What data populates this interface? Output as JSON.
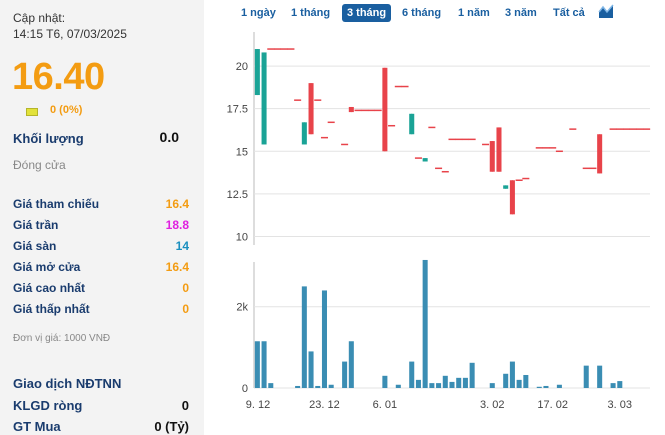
{
  "header": {
    "update_label": "Cập nhật:",
    "update_time": "14:15 T6, 07/03/2025",
    "price": "16.40",
    "change": "0 (0%)",
    "volume_label": "Khối lượng",
    "volume_value": "0.0",
    "close_label": "Đóng cửa"
  },
  "stats": [
    {
      "label": "Giá tham chiếu",
      "value": "16.4",
      "color": "#f39c12"
    },
    {
      "label": "Giá trần",
      "value": "18.8",
      "color": "#e020e0"
    },
    {
      "label": "Giá sàn",
      "value": "14",
      "color": "#1a8fbf"
    },
    {
      "label": "Giá mở cửa",
      "value": "16.4",
      "color": "#f39c12"
    },
    {
      "label": "Giá cao nhất",
      "value": "0",
      "color": "#f39c12"
    },
    {
      "label": "Giá thấp nhất",
      "value": "0",
      "color": "#f39c12"
    }
  ],
  "unit_note": "Đơn vị giá: 1000 VNĐ",
  "foreign": {
    "title": "Giao dịch NĐTNN",
    "net_label": "KLGD ròng",
    "net_value": "0",
    "buy_label": "GT Mua",
    "buy_value": "0 (Tỷ)"
  },
  "tabs": [
    {
      "label": "1 ngày",
      "active": false
    },
    {
      "label": "1 tháng",
      "active": false
    },
    {
      "label": "3 tháng",
      "active": true
    },
    {
      "label": "6 tháng",
      "active": false
    },
    {
      "label": "1 năm",
      "active": false
    },
    {
      "label": "3 năm",
      "active": false
    },
    {
      "label": "Tất cả",
      "active": false
    }
  ],
  "chart_icon": "area-chart-icon",
  "colors": {
    "up": "#1aa396",
    "down": "#e8434a",
    "volume": "#3a8db3",
    "accent": "#1a5fa0"
  },
  "chart_data": {
    "type": "candlestick",
    "price_ticks": [
      "20",
      "17.5",
      "15",
      "12.5",
      "10"
    ],
    "price_tick_values": [
      20,
      17.5,
      15,
      12.5,
      10
    ],
    "price_range": [
      9.5,
      22
    ],
    "volume_ticks": [
      "2k",
      "0"
    ],
    "volume_tick_values": [
      2000,
      0
    ],
    "volume_range": [
      0,
      3100
    ],
    "x_labels": [
      "9. 12",
      "23. 12",
      "6. 01",
      "3. 02",
      "17. 02",
      "3. 03"
    ],
    "x_label_index": [
      0,
      10,
      19,
      35,
      44,
      54
    ],
    "candles": [
      {
        "o": 18.3,
        "h": 21.0,
        "l": 18.3,
        "c": 21.0,
        "v": 1150
      },
      {
        "o": 15.4,
        "h": 20.8,
        "l": 15.4,
        "c": 20.8,
        "v": 1150
      },
      {
        "o": 21.0,
        "h": 21.0,
        "l": 21.0,
        "c": 21.0,
        "v": 120
      },
      {
        "o": 21.0,
        "h": 21.0,
        "l": 21.0,
        "c": 21.0,
        "v": 0
      },
      {
        "o": 21.0,
        "h": 21.0,
        "l": 21.0,
        "c": 21.0,
        "v": 0
      },
      {
        "o": 21.0,
        "h": 21.0,
        "l": 21.0,
        "c": 21.0,
        "v": 0
      },
      {
        "o": 18.0,
        "h": 18.0,
        "l": 18.0,
        "c": 18.0,
        "v": 50
      },
      {
        "o": 15.4,
        "h": 16.7,
        "l": 15.4,
        "c": 16.7,
        "v": 2500
      },
      {
        "o": 19.0,
        "h": 19.0,
        "l": 16.0,
        "c": 16.0,
        "v": 900
      },
      {
        "o": 18.0,
        "h": 18.0,
        "l": 18.0,
        "c": 18.0,
        "v": 50
      },
      {
        "o": 15.8,
        "h": 15.8,
        "l": 15.8,
        "c": 15.8,
        "v": 2400
      },
      {
        "o": 16.7,
        "h": 16.7,
        "l": 16.7,
        "c": 16.7,
        "v": 80
      },
      {
        "o": 0,
        "h": 0,
        "l": 0,
        "c": 0,
        "v": 0
      },
      {
        "o": 15.4,
        "h": 15.4,
        "l": 15.4,
        "c": 15.4,
        "v": 650
      },
      {
        "o": 17.6,
        "h": 17.6,
        "l": 17.3,
        "c": 17.3,
        "v": 1150
      },
      {
        "o": 17.4,
        "h": 17.4,
        "l": 17.4,
        "c": 17.4,
        "v": 0
      },
      {
        "o": 17.4,
        "h": 17.4,
        "l": 17.4,
        "c": 17.4,
        "v": 0
      },
      {
        "o": 17.4,
        "h": 17.4,
        "l": 17.4,
        "c": 17.4,
        "v": 0
      },
      {
        "o": 17.4,
        "h": 17.4,
        "l": 17.4,
        "c": 17.4,
        "v": 0
      },
      {
        "o": 19.9,
        "h": 19.9,
        "l": 15.0,
        "c": 15.0,
        "v": 300
      },
      {
        "o": 16.5,
        "h": 16.5,
        "l": 16.5,
        "c": 16.5,
        "v": 0
      },
      {
        "o": 18.8,
        "h": 18.8,
        "l": 18.8,
        "c": 18.8,
        "v": 80
      },
      {
        "o": 18.8,
        "h": 18.8,
        "l": 18.8,
        "c": 18.8,
        "v": 0
      },
      {
        "o": 16.0,
        "h": 17.2,
        "l": 16.0,
        "c": 17.2,
        "v": 650
      },
      {
        "o": 14.6,
        "h": 14.6,
        "l": 14.6,
        "c": 14.6,
        "v": 200
      },
      {
        "o": 14.4,
        "h": 14.6,
        "l": 14.4,
        "c": 14.6,
        "v": 3150
      },
      {
        "o": 16.4,
        "h": 16.4,
        "l": 16.4,
        "c": 16.4,
        "v": 120
      },
      {
        "o": 14.0,
        "h": 14.0,
        "l": 14.0,
        "c": 14.0,
        "v": 120
      },
      {
        "o": 13.8,
        "h": 13.8,
        "l": 13.8,
        "c": 13.8,
        "v": 300
      },
      {
        "o": 15.7,
        "h": 15.7,
        "l": 15.7,
        "c": 15.7,
        "v": 150
      },
      {
        "o": 15.7,
        "h": 15.7,
        "l": 15.7,
        "c": 15.7,
        "v": 250
      },
      {
        "o": 15.7,
        "h": 15.7,
        "l": 15.7,
        "c": 15.7,
        "v": 250
      },
      {
        "o": 15.7,
        "h": 15.7,
        "l": 15.7,
        "c": 15.7,
        "v": 620
      },
      {
        "o": 0,
        "h": 0,
        "l": 0,
        "c": 0,
        "v": 0
      },
      {
        "o": 15.4,
        "h": 15.4,
        "l": 15.4,
        "c": 15.4,
        "v": 0
      },
      {
        "o": 15.6,
        "h": 15.6,
        "l": 13.8,
        "c": 13.8,
        "v": 120
      },
      {
        "o": 16.4,
        "h": 16.4,
        "l": 13.8,
        "c": 13.8,
        "v": 0
      },
      {
        "o": 12.8,
        "h": 13.0,
        "l": 12.8,
        "c": 13.0,
        "v": 350
      },
      {
        "o": 13.3,
        "h": 13.3,
        "l": 11.3,
        "c": 11.3,
        "v": 650
      },
      {
        "o": 13.3,
        "h": 13.3,
        "l": 13.3,
        "c": 13.3,
        "v": 200
      },
      {
        "o": 13.4,
        "h": 13.4,
        "l": 13.4,
        "c": 13.4,
        "v": 320
      },
      {
        "o": 0,
        "h": 0,
        "l": 0,
        "c": 0,
        "v": 0
      },
      {
        "o": 15.2,
        "h": 15.2,
        "l": 15.2,
        "c": 15.2,
        "v": 30
      },
      {
        "o": 15.2,
        "h": 15.2,
        "l": 15.2,
        "c": 15.2,
        "v": 50
      },
      {
        "o": 15.2,
        "h": 15.2,
        "l": 15.2,
        "c": 15.2,
        "v": 0
      },
      {
        "o": 15.0,
        "h": 15.0,
        "l": 15.0,
        "c": 15.0,
        "v": 80
      },
      {
        "o": 0,
        "h": 0,
        "l": 0,
        "c": 0,
        "v": 0
      },
      {
        "o": 16.3,
        "h": 16.3,
        "l": 16.3,
        "c": 16.3,
        "v": 0
      },
      {
        "o": 0,
        "h": 0,
        "l": 0,
        "c": 0,
        "v": 0
      },
      {
        "o": 14.0,
        "h": 14.0,
        "l": 14.0,
        "c": 14.0,
        "v": 550
      },
      {
        "o": 14.0,
        "h": 14.0,
        "l": 14.0,
        "c": 14.0,
        "v": 0
      },
      {
        "o": 16.0,
        "h": 16.0,
        "l": 13.7,
        "c": 13.7,
        "v": 550
      },
      {
        "o": 0,
        "h": 0,
        "l": 0,
        "c": 0,
        "v": 0
      },
      {
        "o": 16.3,
        "h": 16.3,
        "l": 16.3,
        "c": 16.3,
        "v": 120
      },
      {
        "o": 16.3,
        "h": 16.3,
        "l": 16.3,
        "c": 16.3,
        "v": 170
      },
      {
        "o": 16.3,
        "h": 16.3,
        "l": 16.3,
        "c": 16.3,
        "v": 0
      },
      {
        "o": 16.3,
        "h": 16.3,
        "l": 16.3,
        "c": 16.3,
        "v": 0
      },
      {
        "o": 16.3,
        "h": 16.3,
        "l": 16.3,
        "c": 16.3,
        "v": 0
      },
      {
        "o": 16.3,
        "h": 16.3,
        "l": 16.3,
        "c": 16.3,
        "v": 0
      }
    ]
  }
}
